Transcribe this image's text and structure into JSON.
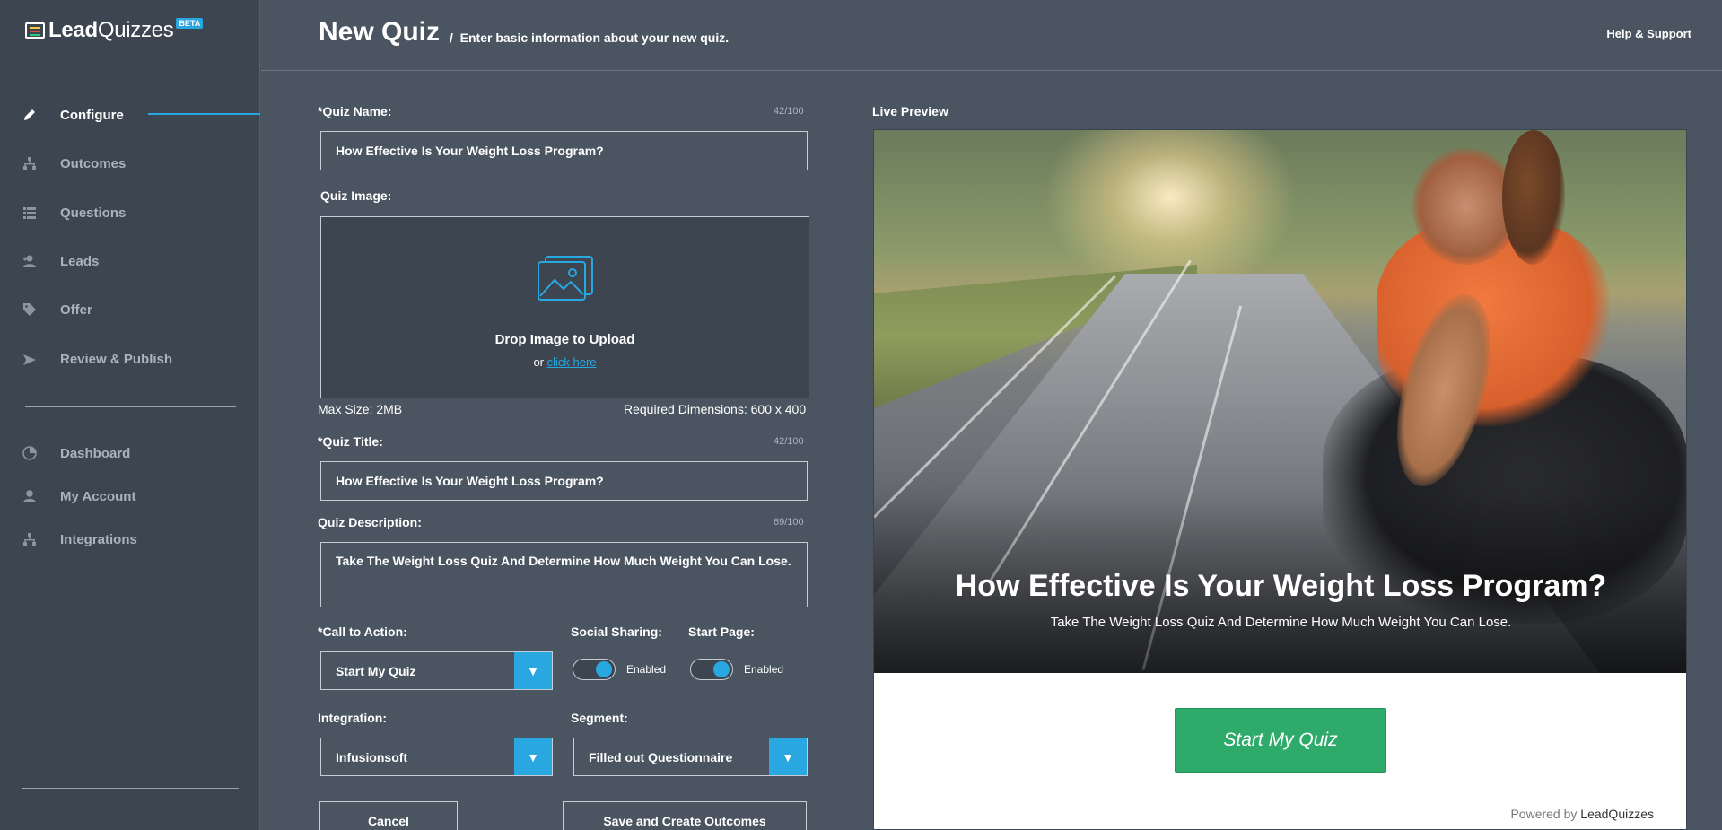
{
  "app": {
    "logo_text_bold": "Lead",
    "logo_text": "Quizzes",
    "beta": "BETA"
  },
  "header": {
    "title": "New Quiz",
    "separator": "/",
    "subtitle": "Enter basic information about your new quiz.",
    "help": "Help & Support"
  },
  "sidebar": {
    "items": [
      {
        "label": "Configure",
        "icon": "pencil-icon"
      },
      {
        "label": "Outcomes",
        "icon": "hierarchy-icon"
      },
      {
        "label": "Questions",
        "icon": "list-icon"
      },
      {
        "label": "Leads",
        "icon": "user-plus-icon"
      },
      {
        "label": "Offer",
        "icon": "tag-icon"
      },
      {
        "label": "Review & Publish",
        "icon": "send-icon"
      }
    ],
    "secondary": [
      {
        "label": "Dashboard",
        "icon": "pie-chart-icon"
      },
      {
        "label": "My Account",
        "icon": "user-icon"
      },
      {
        "label": "Integrations",
        "icon": "hierarchy-icon"
      }
    ]
  },
  "form": {
    "quiz_name": {
      "label": "*Quiz Name:",
      "counter": "42/100",
      "value": "How Effective Is Your Weight Loss Program?"
    },
    "quiz_image": {
      "label": "Quiz Image:",
      "drop_text": "Drop Image to Upload",
      "or_text": "or",
      "click_text": "click here",
      "max_size": "Max Size: 2MB",
      "dimensions": "Required Dimensions: 600 x 400"
    },
    "quiz_title": {
      "label": "*Quiz Title:",
      "counter": "42/100",
      "value": "How Effective Is Your Weight Loss Program?"
    },
    "quiz_description": {
      "label": "Quiz Description:",
      "counter": "69/100",
      "value": "Take The Weight Loss Quiz And Determine How Much Weight You Can Lose."
    },
    "call_to_action": {
      "label": "*Call to Action:",
      "value": "Start My Quiz"
    },
    "social_sharing": {
      "label": "Social Sharing:",
      "state": "Enabled"
    },
    "start_page": {
      "label": "Start Page:",
      "state": "Enabled"
    },
    "integration": {
      "label": "Integration:",
      "value": "Infusionsoft"
    },
    "segment": {
      "label": "Segment:",
      "value": "Filled out Questionnaire"
    },
    "cancel": "Cancel",
    "save": "Save and Create Outcomes"
  },
  "preview": {
    "label": "Live Preview",
    "title": "How Effective Is Your Weight Loss Program?",
    "description": "Take The Weight Loss Quiz And Determine How Much Weight You Can Lose.",
    "cta": "Start My Quiz",
    "powered_by": "Powered by",
    "powered_brand": "LeadQuizzes"
  },
  "colors": {
    "accent": "#29a7e1",
    "sidebar": "#3c4550",
    "main": "#4a5561",
    "cta": "#2eaa6a"
  }
}
